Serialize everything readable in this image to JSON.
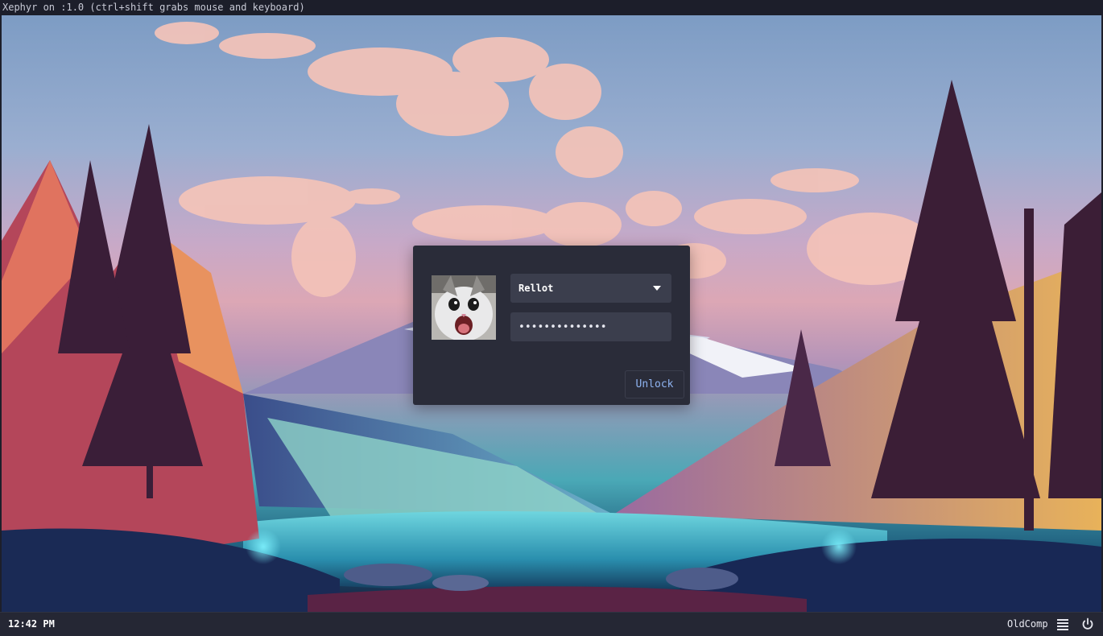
{
  "window": {
    "title": "Xephyr on :1.0 (ctrl+shift grabs mouse and keyboard)"
  },
  "lock_dialog": {
    "avatar_icon": "cat-avatar",
    "user_selected": "Rellot",
    "password_masked": "••••••••••••••",
    "unlock_label": "Unlock"
  },
  "panel": {
    "clock": "12:42 PM",
    "hostname": "OldComp",
    "menu_icon": "hamburger-menu-icon",
    "power_icon": "power-icon"
  },
  "colors": {
    "dialog_bg": "#2a2c39",
    "field_bg": "#3b3e4d",
    "accent": "#8fb4f2",
    "panel_bg": "#252734"
  }
}
